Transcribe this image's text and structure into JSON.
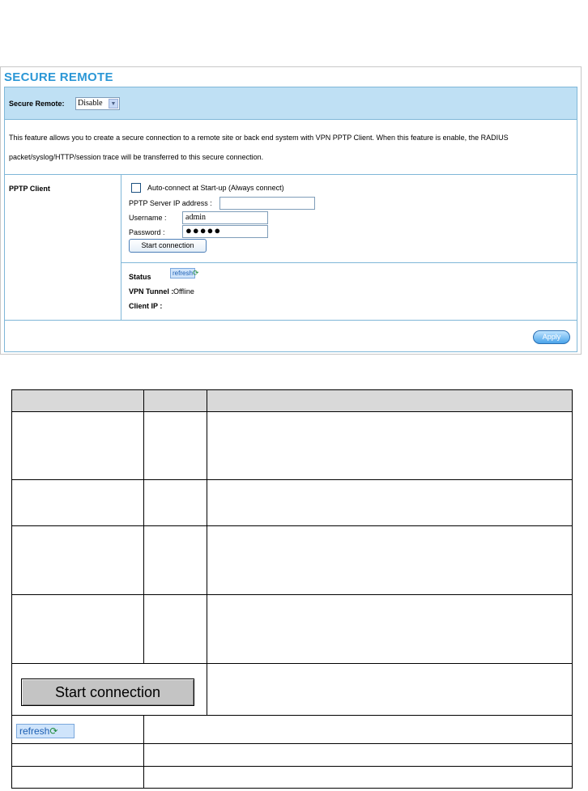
{
  "panel": {
    "title": "SECURE REMOTE",
    "secure_remote_label": "Secure Remote:",
    "secure_remote_value": "Disable",
    "description": "This feature allows you to create a secure connection to a remote site or back end system with VPN PPTP Client. When this feature is enable, the RADIUS packet/syslog/HTTP/session trace will be transferred to this secure connection.",
    "pptp_client_label": "PPTP Client",
    "auto_connect_label": "Auto-connect at Start-up (Always connect)",
    "auto_connect_checked": false,
    "server_ip_label": "PPTP Server IP address :",
    "server_ip_value": "",
    "username_label": "Username :",
    "username_value": "admin",
    "password_label": "Password :",
    "password_mask": "●●●●●",
    "start_button": "Start connection",
    "status_label": "Status",
    "refresh_button": "refresh",
    "vpn_tunnel_label": "VPN Tunnel :",
    "vpn_tunnel_value": "Offline",
    "client_ip_label": "Client IP :",
    "client_ip_value": "",
    "apply_button": "Apply"
  },
  "table": {
    "start_button": "Start connection",
    "refresh_button": "refresh"
  },
  "icons": {
    "dropdown": "chevron-down-icon",
    "refresh": "refresh-icon"
  },
  "colors": {
    "title_blue": "#2b97d6",
    "row_highlight": "#bfe0f4",
    "header_gray": "#d9d9d9"
  }
}
